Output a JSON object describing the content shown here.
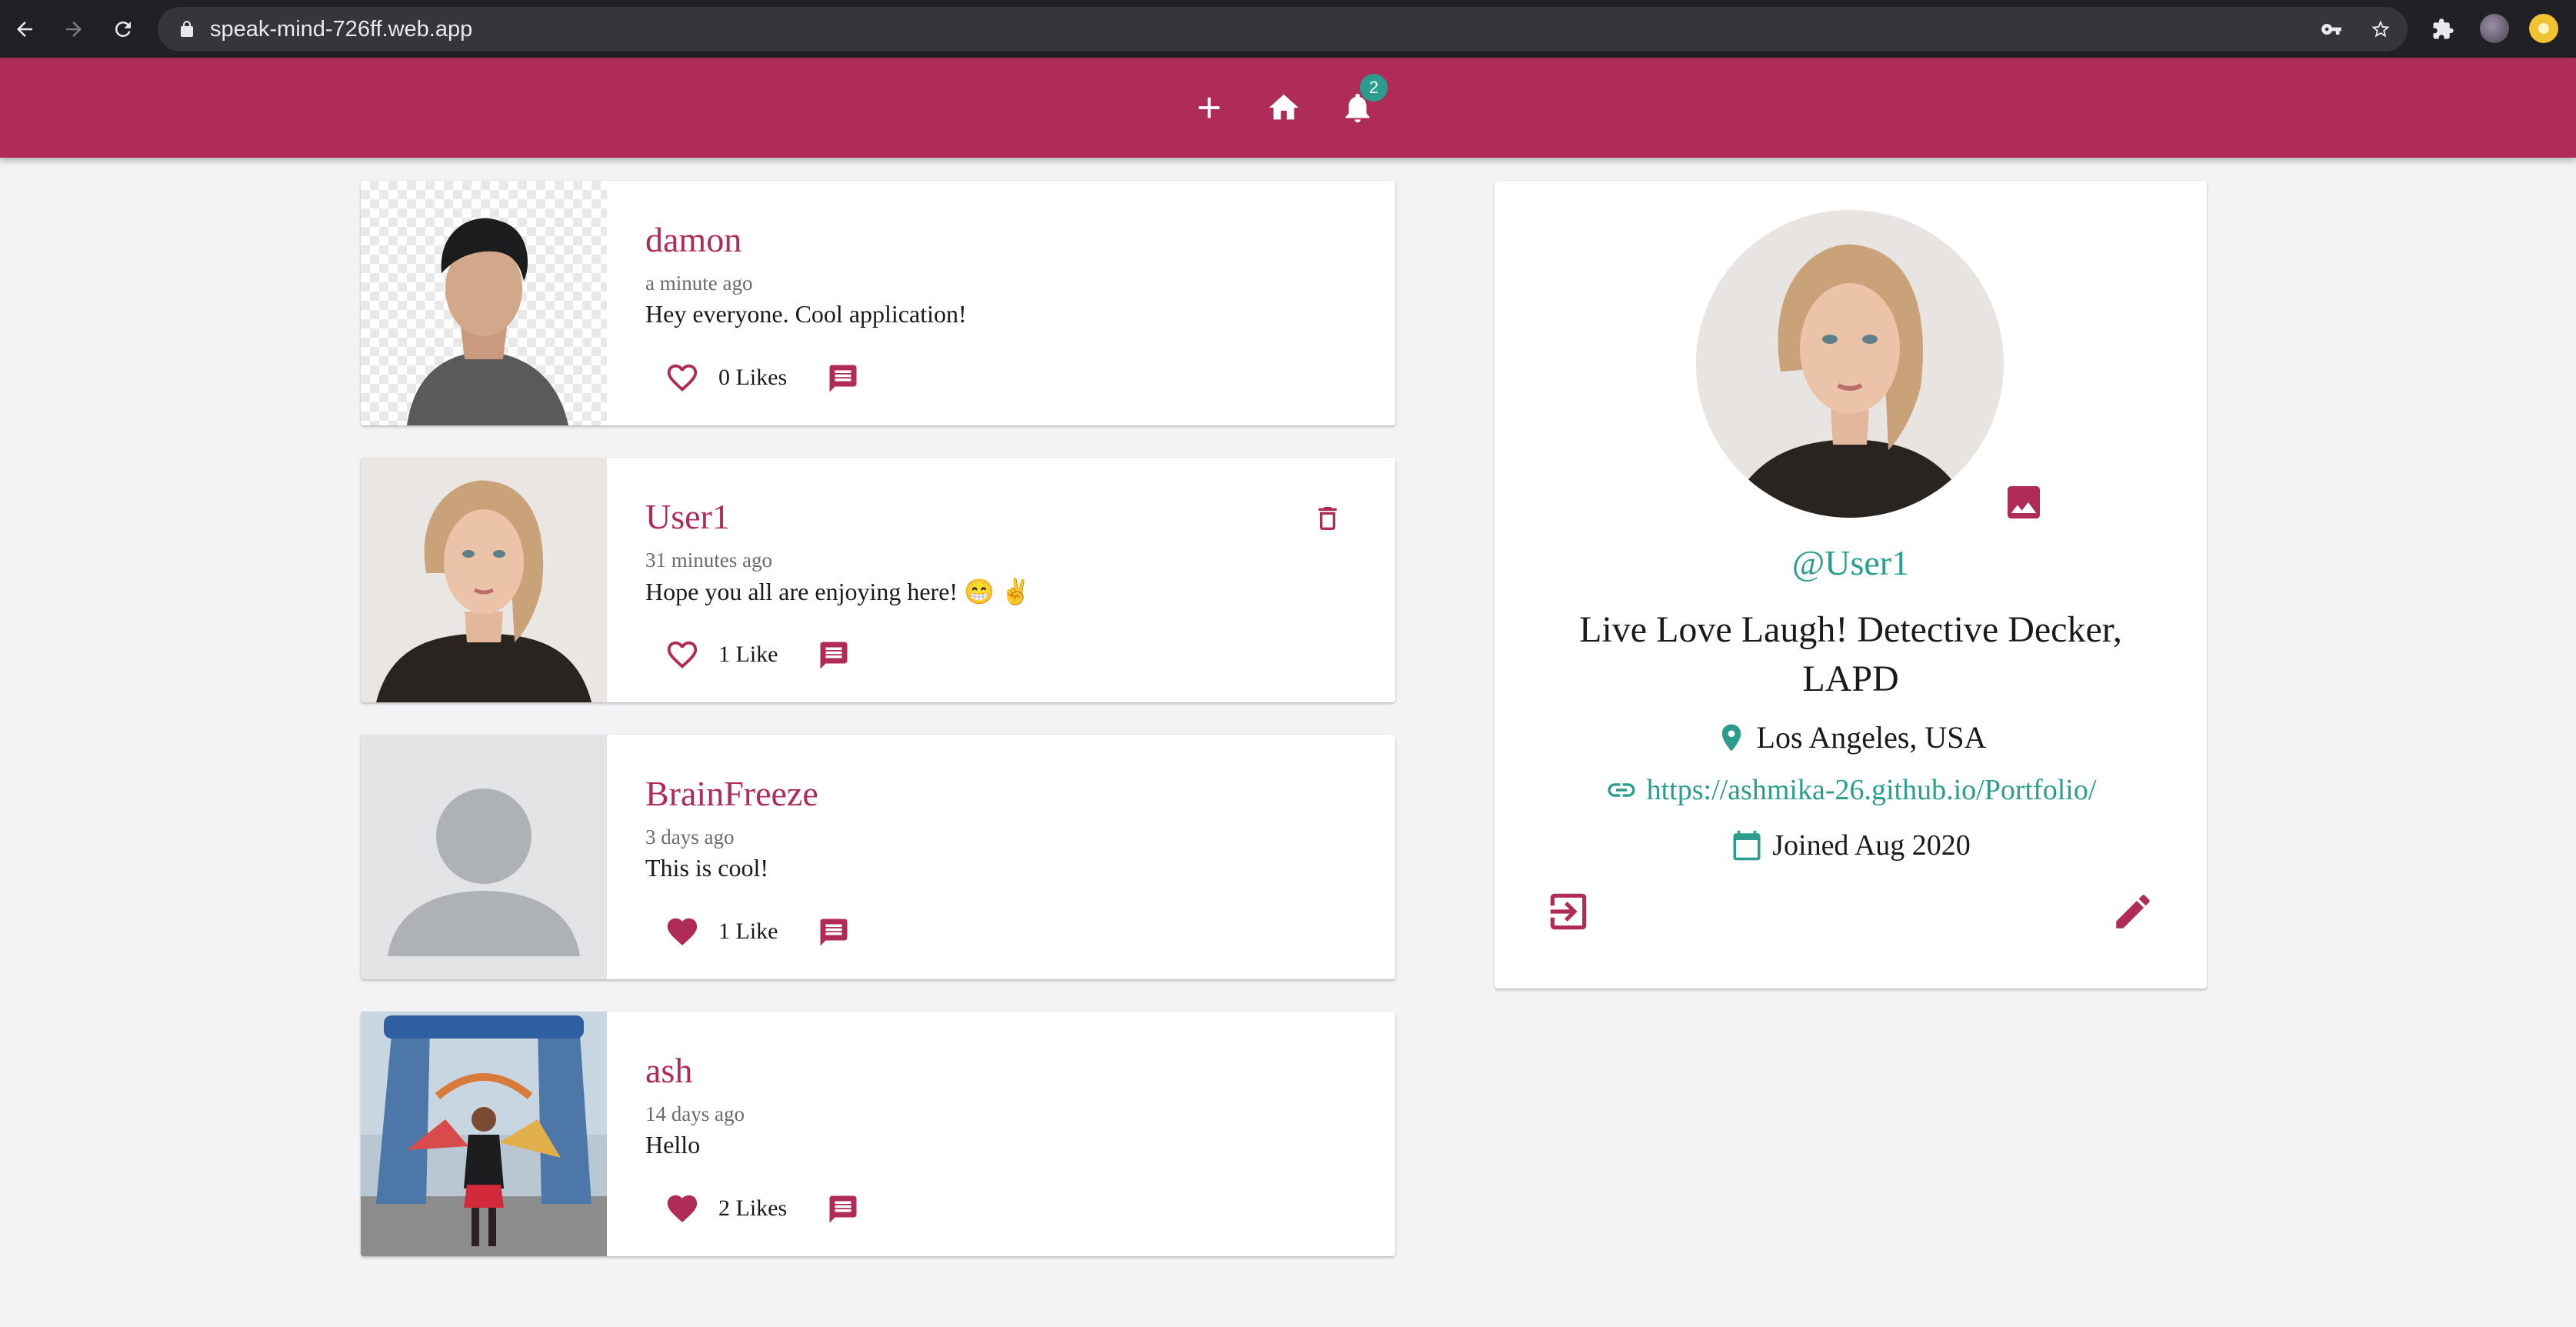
{
  "browser": {
    "url": "speak-mind-726ff.web.app",
    "icons": [
      "back-arrow-icon",
      "forward-arrow-icon",
      "reload-icon",
      "lock-icon",
      "key-icon",
      "star-icon",
      "extensions-icon"
    ]
  },
  "appbar": {
    "icons": [
      "plus-icon",
      "home-icon",
      "bell-icon"
    ],
    "notification_count": "2",
    "color": "#b02c58"
  },
  "posts": [
    {
      "handle": "damon",
      "time": "a minute ago",
      "body": "Hey everyone. Cool application!",
      "likes": "0 Likes",
      "liked": false
    },
    {
      "handle": "User1",
      "time": "31 minutes ago",
      "body": "Hope you all are enjoying here! 😁 ✌️",
      "likes": "1 Like",
      "liked": false,
      "deletable": true
    },
    {
      "handle": "BrainFreeze",
      "time": "3 days ago",
      "body": "This is cool!",
      "likes": "1 Like",
      "liked": true
    },
    {
      "handle": "ash",
      "time": "14 days ago",
      "body": "Hello",
      "likes": "2 Likes",
      "liked": true
    }
  ],
  "profile": {
    "handle": "@User1",
    "bio": "Live Love Laugh! Detective Decker, LAPD",
    "location": "Los Angeles, USA",
    "website": "https://ashmika-26.github.io/Portfolio/",
    "joined": "Joined Aug 2020"
  },
  "colors": {
    "primary": "#b02c58",
    "secondary": "#2a9d8f",
    "background": "#f3f2f4"
  }
}
